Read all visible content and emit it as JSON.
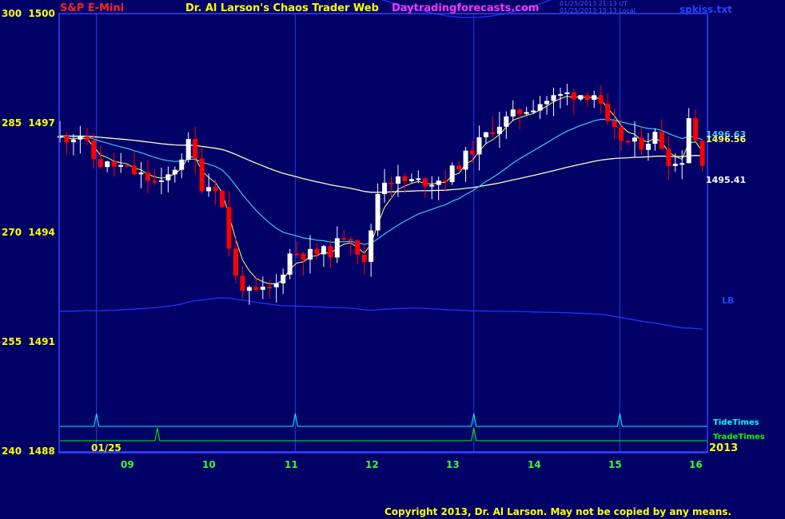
{
  "header": {
    "symbol": "S&P E-Mini",
    "title": "Dr. Al Larson's Chaos Trader Web",
    "site": "Daytradingforecasts.com",
    "time_ut": "01/25/2013 21:13 UT",
    "time_local": "01/25/2013 15:13 Local",
    "filename": "spkiss.txt"
  },
  "colors": {
    "background": "#000066",
    "axis": "#3344ff",
    "up_bar": "#ffffff",
    "down_bar": "#ff0000",
    "ma_fast": "#ffff66",
    "ma_mid": "#33ccff",
    "ma_slow": "#ffffcc",
    "bands": "#2233ff",
    "tide": "#00ffff",
    "trade": "#00ff00"
  },
  "y_axis_labels": [
    {
      "left": "300",
      "right": "1500"
    },
    {
      "left": "285",
      "right": "1497"
    },
    {
      "left": "270",
      "right": "1494"
    },
    {
      "left": "255",
      "right": "1491"
    },
    {
      "left": "240",
      "right": "1488"
    }
  ],
  "x_axis_labels": [
    "09",
    "10",
    "11",
    "12",
    "13",
    "14",
    "15",
    "16"
  ],
  "date_label": "01/25",
  "year_label": "2013",
  "price_tags": [
    {
      "text": "1496.63",
      "color": "#33ccff"
    },
    {
      "text": "1496.56",
      "color": "#ffff66"
    },
    {
      "text": "1495.41",
      "color": "#ffffcc"
    }
  ],
  "lb_label": "LB",
  "tide_label": "TideTimes",
  "trade_label": "TradeTimes",
  "copyright": "Copyright 2013, Dr. Al Larson. May not be copied by any means.",
  "chart_data": {
    "type": "candlestick",
    "title": "S&P E-Mini",
    "x_unit": "hour",
    "x_range": [
      8.25,
      16.2
    ],
    "y_range": [
      1488,
      1500
    ],
    "grid": false,
    "vertical_markers_hours": [
      8.7,
      11.15,
      13.35,
      15.15
    ],
    "tide_peaks_hours": [
      8.7,
      11.15,
      13.35,
      15.15
    ],
    "trade_peaks_hours": [
      9.45,
      13.35
    ],
    "price_anchors": [
      {
        "hour": 8.3,
        "price": 1496.6
      },
      {
        "hour": 8.5,
        "price": 1496.7
      },
      {
        "hour": 8.7,
        "price": 1495.9
      },
      {
        "hour": 9.0,
        "price": 1495.8
      },
      {
        "hour": 9.3,
        "price": 1495.5
      },
      {
        "hour": 9.5,
        "price": 1495.3
      },
      {
        "hour": 9.7,
        "price": 1495.9
      },
      {
        "hour": 9.85,
        "price": 1496.5
      },
      {
        "hour": 10.0,
        "price": 1495.3
      },
      {
        "hour": 10.2,
        "price": 1495.3
      },
      {
        "hour": 10.4,
        "price": 1492.8
      },
      {
        "hour": 10.6,
        "price": 1492.3
      },
      {
        "hour": 10.9,
        "price": 1492.5
      },
      {
        "hour": 11.1,
        "price": 1493.5
      },
      {
        "hour": 11.3,
        "price": 1493.4
      },
      {
        "hour": 11.6,
        "price": 1493.5
      },
      {
        "hour": 11.8,
        "price": 1494.1
      },
      {
        "hour": 12.0,
        "price": 1493.1
      },
      {
        "hour": 12.2,
        "price": 1495.5
      },
      {
        "hour": 12.5,
        "price": 1495.4
      },
      {
        "hour": 12.8,
        "price": 1495.4
      },
      {
        "hour": 13.0,
        "price": 1495.5
      },
      {
        "hour": 13.3,
        "price": 1496.2
      },
      {
        "hour": 13.6,
        "price": 1496.9
      },
      {
        "hour": 13.9,
        "price": 1497.3
      },
      {
        "hour": 14.2,
        "price": 1497.6
      },
      {
        "hour": 14.5,
        "price": 1497.8
      },
      {
        "hour": 14.85,
        "price": 1497.8
      },
      {
        "hour": 15.0,
        "price": 1496.9
      },
      {
        "hour": 15.2,
        "price": 1496.5
      },
      {
        "hour": 15.4,
        "price": 1496.4
      },
      {
        "hour": 15.6,
        "price": 1496.7
      },
      {
        "hour": 15.75,
        "price": 1496.0
      },
      {
        "hour": 15.9,
        "price": 1495.8
      },
      {
        "hour": 16.0,
        "price": 1497.2
      },
      {
        "hour": 16.15,
        "price": 1496.0
      }
    ],
    "moving_averages": [
      {
        "name": "1496.56",
        "last": 1496.56
      },
      {
        "name": "1496.63",
        "last": 1496.63
      },
      {
        "name": "1495.41",
        "last": 1495.41
      }
    ]
  }
}
